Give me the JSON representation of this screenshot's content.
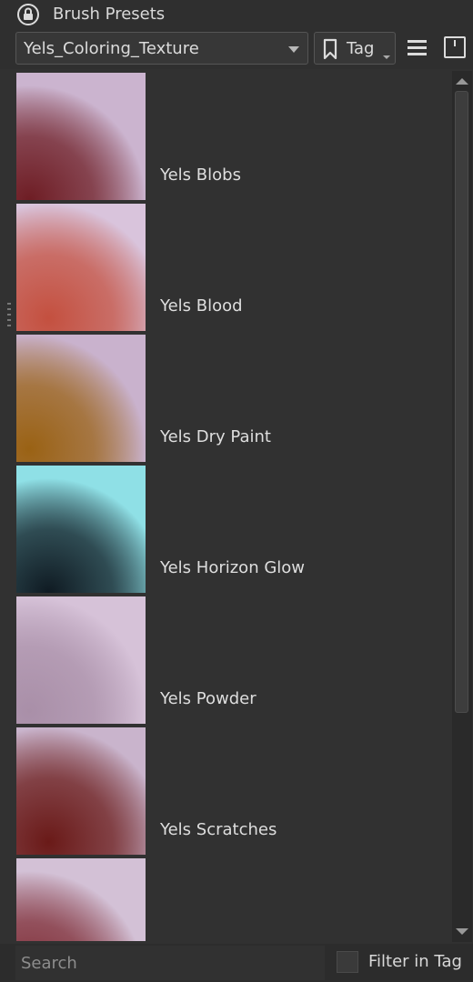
{
  "panel": {
    "title": "Brush Presets",
    "title_icon": "lock-icon"
  },
  "toolbar": {
    "tag_selected": "Yels_Coloring_Texture",
    "tag_button_label": "Tag",
    "tag_button_icon": "bookmark-icon",
    "menu_icon": "hamburger-menu-icon",
    "view_icon": "view-mode-icon"
  },
  "presets": [
    {
      "label": "Yels Blobs",
      "swatch": [
        "#6e1d24",
        "#cbb4cf"
      ]
    },
    {
      "label": "Yels Blood",
      "swatch": [
        "#c4503f",
        "#d9c4dc"
      ]
    },
    {
      "label": "Yels Dry Paint",
      "swatch": [
        "#9a6214",
        "#c9b2cd"
      ]
    },
    {
      "label": "Yels Horizon Glow",
      "swatch": [
        "#0f1a22",
        "#8fe0e6"
      ]
    },
    {
      "label": "Yels Powder",
      "swatch": [
        "#a98fa8",
        "#d6c2d8"
      ]
    },
    {
      "label": "Yels Scratches",
      "swatch": [
        "#6a1a18",
        "#c9b4cc"
      ]
    },
    {
      "label": "",
      "swatch": [
        "#7d2a33",
        "#d3c1d6"
      ]
    }
  ],
  "footer": {
    "search_placeholder": "Search",
    "filter_label": "Filter in Tag",
    "filter_checked": false
  }
}
